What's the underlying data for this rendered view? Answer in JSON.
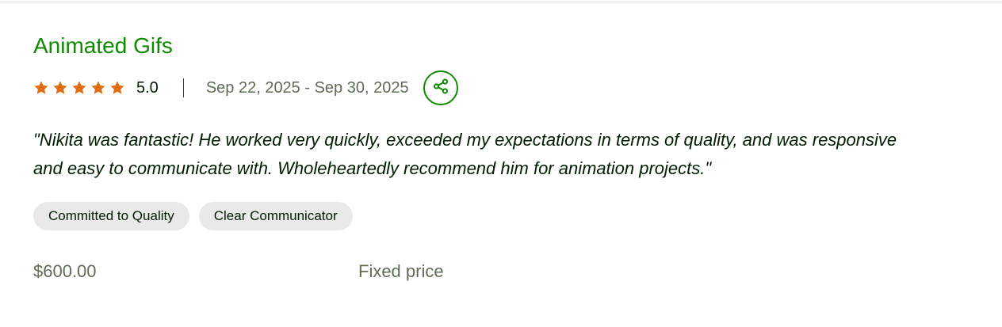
{
  "review": {
    "title": "Animated Gifs",
    "rating": "5.0",
    "stars_filled": 5,
    "stars_total": 5,
    "date_range": "Sep 22, 2025 - Sep 30, 2025",
    "share_icon": "share-icon",
    "feedback": "\"Nikita was fantastic! He worked very quickly, exceeded my expectations in terms of quality, and was responsive and easy to communicate with. Wholeheartedly recommend him for animation projects.\"",
    "tags": [
      "Committed to Quality",
      "Clear Communicator"
    ],
    "price": "$600.00",
    "price_type": "Fixed price"
  },
  "colors": {
    "accent": "#108a00",
    "star": "#e06d10",
    "muted_text": "#5e6d55",
    "tag_bg": "#e9e9e9"
  }
}
